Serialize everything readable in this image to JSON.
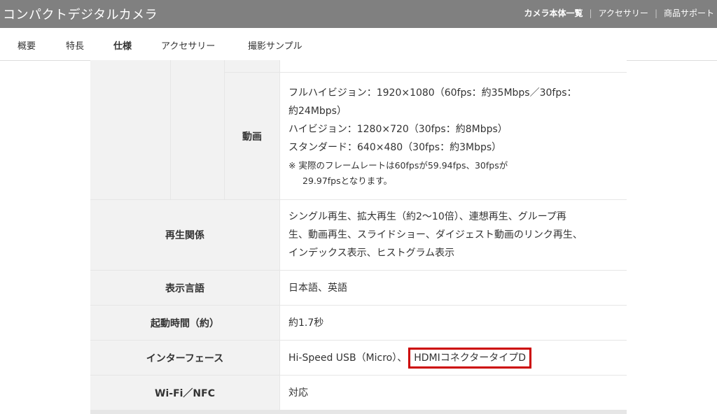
{
  "header": {
    "site_title": "コンパクトデジタルカメラ",
    "links": [
      "カメラ本体一覧",
      "アクセサリー",
      "商品サポート"
    ],
    "separator": "|"
  },
  "tabs": [
    {
      "label": "概要"
    },
    {
      "label": "特長"
    },
    {
      "label": "仕様",
      "active": true
    },
    {
      "label": "アクセサリー"
    },
    {
      "label": "撮影サンプル"
    }
  ],
  "spec": {
    "movie": {
      "label": "動画",
      "lines": [
        "フルハイビジョン：1920×1080（60fps：約35Mbps／30fps：",
        "約24Mbps）",
        "ハイビジョン：1280×720（30fps：約8Mbps）",
        "スタンダード：640×480（30fps：約3Mbps）"
      ],
      "note_lines": [
        "※ 実際のフレームレートは60fpsが59.94fps、30fpsが",
        "29.97fpsとなります。"
      ]
    },
    "playback": {
      "label": "再生関係",
      "lines": [
        "シングル再生、拡大再生（約2～10倍）、連想再生、グループ再",
        "生、動画再生、スライドショー、ダイジェスト動画のリンク再生、",
        "インデックス表示、ヒストグラム表示"
      ]
    },
    "language": {
      "label": "表示言語",
      "value": "日本語、英語"
    },
    "startup": {
      "label": "起動時間（約）",
      "value": "約1.7秒"
    },
    "interface": {
      "label": "インターフェース",
      "value_prefix": "Hi-Speed USB（Micro）、",
      "value_highlight": "HDMIコネクタータイプD"
    },
    "wifi": {
      "label": "Wi-Fi／NFC",
      "value": "対応"
    }
  },
  "colors": {
    "topbar": "#808080",
    "header_cell": "#f2f2f2",
    "border": "#e6e6e6",
    "highlight": "#cc0000"
  }
}
